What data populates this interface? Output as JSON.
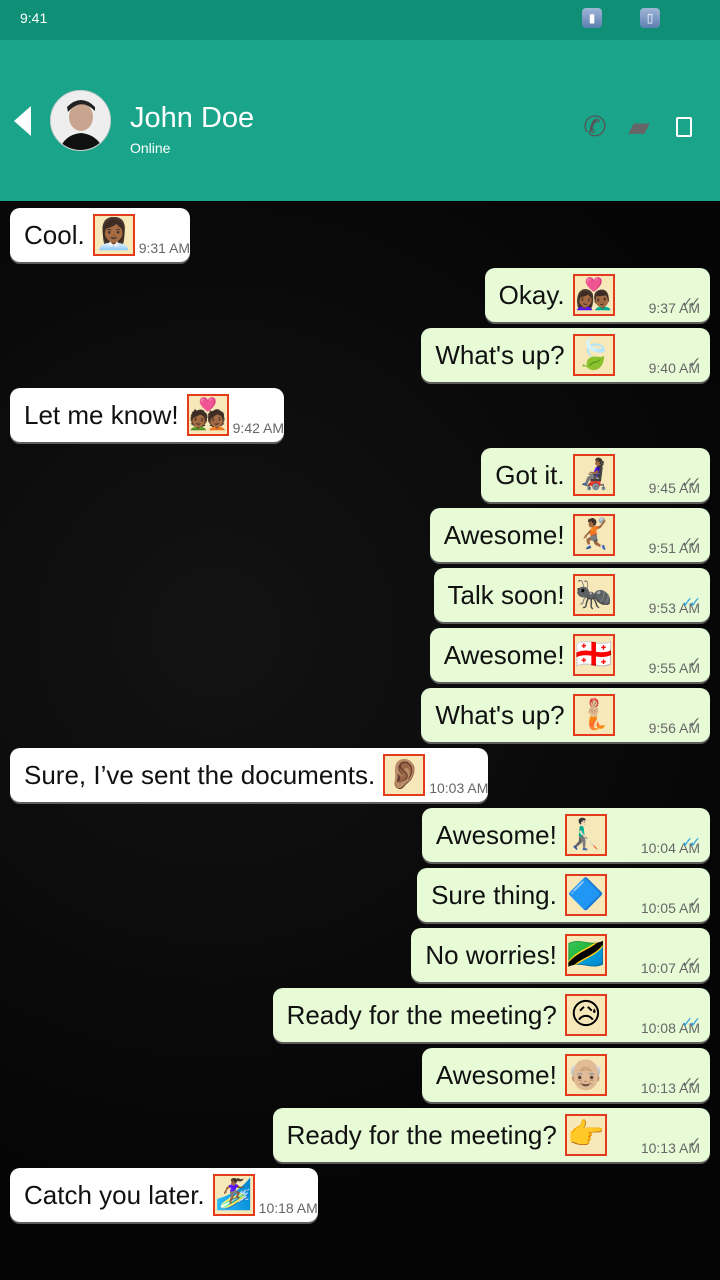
{
  "status_bar": {
    "time": "9:41"
  },
  "contact": {
    "name": "John Doe",
    "status": "Online"
  },
  "icons": {
    "back": "back-arrow-icon",
    "phone": "phone-icon",
    "video": "video-camera-icon",
    "menu": "more-menu-icon",
    "signal": "signal-icon",
    "battery": "battery-icon"
  },
  "colors": {
    "header": "#1aa58a",
    "status_bar": "#0f8f75",
    "incoming_bubble": "#ffffff",
    "outgoing_bubble": "#e6fbd6",
    "chat_background": "#0b0b0b",
    "read_tick": "#2a9de3"
  },
  "messages": [
    {
      "dir": "in",
      "text": "Cool.",
      "emoji": "👩🏾‍💼",
      "time": "9:31 AM"
    },
    {
      "dir": "out",
      "text": "Okay.",
      "emoji": "👩🏾‍❤️‍👨🏾",
      "time": "9:37 AM",
      "status": "delivered"
    },
    {
      "dir": "out",
      "text": "What's up?",
      "emoji": "🍃",
      "time": "9:40 AM",
      "status": "sent"
    },
    {
      "dir": "in",
      "text": "Let me know!",
      "emoji": "💑🏾",
      "time": "9:42 AM"
    },
    {
      "dir": "out",
      "text": "Got it.",
      "emoji": "👩🏾‍🦼",
      "time": "9:45 AM",
      "status": "delivered"
    },
    {
      "dir": "out",
      "text": "Awesome!",
      "emoji": "🤾🏾",
      "time": "9:51 AM",
      "status": "delivered"
    },
    {
      "dir": "out",
      "text": "Talk soon!",
      "emoji": "🐜",
      "time": "9:53 AM",
      "status": "read"
    },
    {
      "dir": "out",
      "text": "Awesome!",
      "emoji": "🇬🇪",
      "time": "9:55 AM",
      "status": "sent"
    },
    {
      "dir": "out",
      "text": "What's up?",
      "emoji": "🧜🏼",
      "time": "9:56 AM",
      "status": "sent"
    },
    {
      "dir": "in",
      "text": "Sure, I’ve sent the documents.",
      "emoji": "👂🏽",
      "time": "10:03 AM"
    },
    {
      "dir": "out",
      "text": "Awesome!",
      "emoji": "👨🏻‍🦯‍➡️",
      "time": "10:04 AM",
      "status": "read"
    },
    {
      "dir": "out",
      "text": "Sure thing.",
      "emoji": "🔷",
      "time": "10:05 AM",
      "status": "sent"
    },
    {
      "dir": "out",
      "text": "No worries!",
      "emoji": "🇹🇿",
      "time": "10:07 AM",
      "status": "delivered"
    },
    {
      "dir": "out",
      "text": "Ready for the meeting?",
      "emoji": "😥",
      "time": "10:08 AM",
      "status": "read"
    },
    {
      "dir": "out",
      "text": "Awesome!",
      "emoji": "👴🏼",
      "time": "10:13 AM",
      "status": "delivered"
    },
    {
      "dir": "out",
      "text": "Ready for the meeting?",
      "emoji": "👉",
      "time": "10:13 AM",
      "status": "sent"
    },
    {
      "dir": "in",
      "text": "Catch you later.",
      "emoji": "🏄🏾‍♀️",
      "time": "10:18 AM"
    }
  ]
}
